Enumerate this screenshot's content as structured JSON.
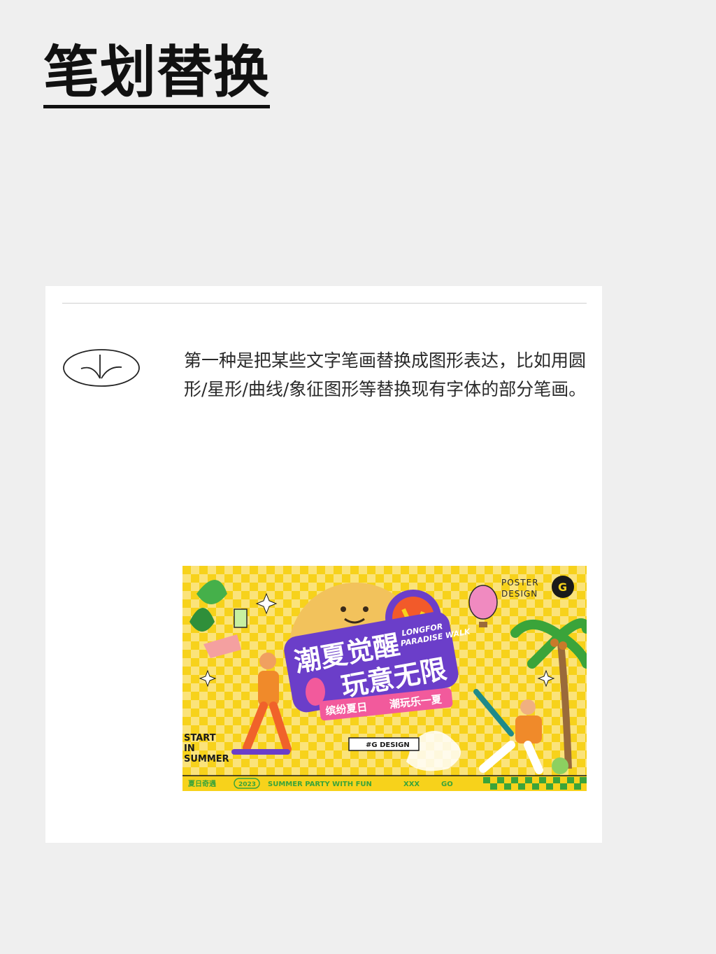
{
  "page": {
    "title": "笔划替换"
  },
  "card": {
    "description": "第一种是把某些文字笔画替换成图形表达，比如用圆形/星形/曲线/象征图形等替换现有字体的部分笔画。"
  },
  "poster": {
    "headline_line1": "潮夏觉醒",
    "headline_line2": "玩意无限",
    "subtitle_en_line1": "LONGFOR",
    "subtitle_en_line2": "PARADISE WALK",
    "ribbon_left": "缤纷夏日",
    "ribbon_right": "潮玩乐一夏",
    "brand_top_line1": "POSTER",
    "brand_top_line2": "DESIGN",
    "brand_logo": "G",
    "tag": "#G DESIGN",
    "start_line1": "START",
    "start_line2": "IN",
    "start_line3": "SUMMER",
    "footer_left": "夏日奇遇",
    "footer_badge": "2023",
    "footer_center": "SUMMER PARTY WITH FUN",
    "footer_xxx": "XXX",
    "footer_go": "GO",
    "colors": {
      "yellow": "#f7d21b",
      "purple": "#6b3ec9",
      "orange": "#f08a2a",
      "pink": "#f25a9c",
      "green": "#3aa43a"
    }
  }
}
